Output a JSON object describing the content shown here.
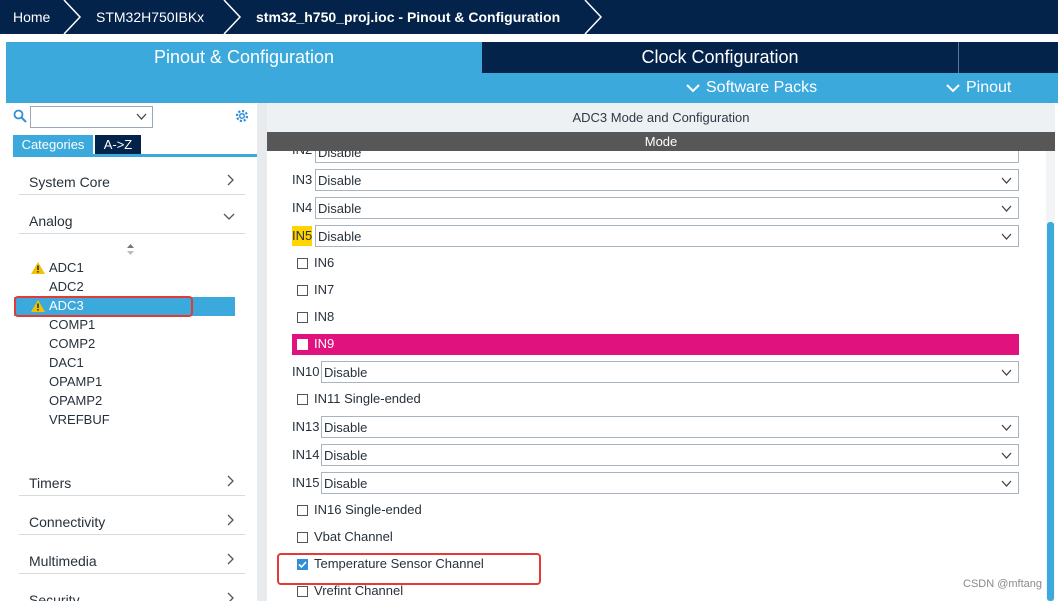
{
  "breadcrumb": {
    "home": "Home",
    "device": "STM32H750IBKx",
    "project": "stm32_h750_proj.ioc - Pinout & Configuration"
  },
  "tabs": {
    "pinout": "Pinout & Configuration",
    "clock": "Clock Configuration"
  },
  "subbar": {
    "software_packs": "Software Packs",
    "pinout": "Pinout"
  },
  "sidebar": {
    "categories_tab": "Categories",
    "az_tab": "A->Z",
    "categories": {
      "system_core": "System Core",
      "analog": "Analog",
      "timers": "Timers",
      "connectivity": "Connectivity",
      "multimedia": "Multimedia",
      "security": "Security"
    },
    "peripherals": [
      "ADC1",
      "ADC2",
      "ADC3",
      "COMP1",
      "COMP2",
      "DAC1",
      "OPAMP1",
      "OPAMP2",
      "VREFBUF"
    ]
  },
  "panel": {
    "title": "ADC3 Mode and Configuration",
    "mode_header": "Mode",
    "partial_label": "IN2",
    "partial_value": "Disable",
    "selects": [
      {
        "label": "IN3",
        "value": "Disable"
      },
      {
        "label": "IN4",
        "value": "Disable"
      },
      {
        "label": "IN5",
        "value": "Disable"
      },
      {
        "label": "IN10",
        "value": "Disable"
      },
      {
        "label": "IN13",
        "value": "Disable"
      },
      {
        "label": "IN14",
        "value": "Disable"
      },
      {
        "label": "IN15",
        "value": "Disable"
      }
    ],
    "checkboxes": [
      {
        "label": "IN6",
        "checked": false
      },
      {
        "label": "IN7",
        "checked": false
      },
      {
        "label": "IN8",
        "checked": false
      },
      {
        "label": "IN9",
        "checked": false
      },
      {
        "label": "IN11 Single-ended",
        "checked": false
      },
      {
        "label": "IN16 Single-ended",
        "checked": false
      },
      {
        "label": "Vbat Channel",
        "checked": false
      },
      {
        "label": "Temperature Sensor Channel",
        "checked": true
      },
      {
        "label": "Vrefint Channel",
        "checked": false
      }
    ]
  },
  "watermark": "CSDN @mftang",
  "colors": {
    "navy": "#03234b",
    "accent_blue": "#3ca9dd",
    "highlight_pink": "#e0127d",
    "highlight_yellow": "#ffd400",
    "annotation_red": "#e53935"
  }
}
